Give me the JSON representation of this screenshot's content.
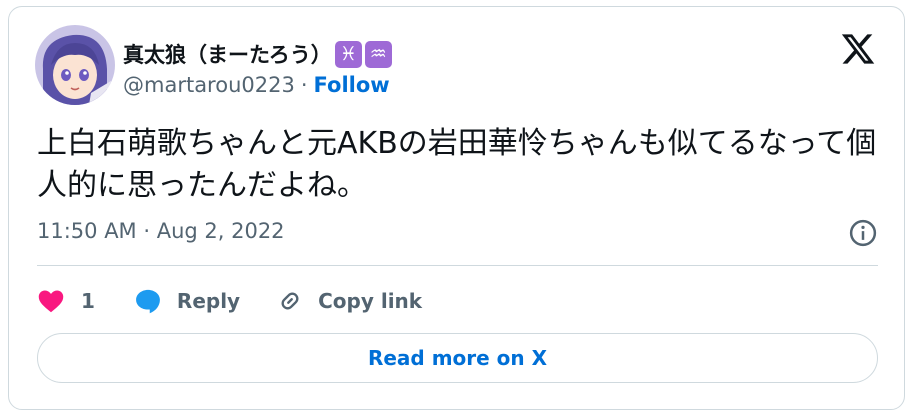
{
  "author": {
    "display_name": "真太狼（まーたろう）",
    "badges": [
      {
        "name": "pisces-icon",
        "glyph": "♓"
      },
      {
        "name": "aquarius-icon",
        "glyph": "♒"
      }
    ],
    "handle": "@martarou0223",
    "separator": "·",
    "follow_label": "Follow"
  },
  "tweet": {
    "text": "上白石萌歌ちゃんと元AKBの岩田華怜ちゃんも似てるなって個人的に思ったんだよね。",
    "timestamp": "11:50 AM · Aug 2, 2022"
  },
  "actions": {
    "like_count": "1",
    "reply_label": "Reply",
    "copy_link_label": "Copy link"
  },
  "read_more_label": "Read more on X",
  "colors": {
    "accent": "#006fd6",
    "like": "#f91880",
    "reply": "#1d9bf0",
    "secondary_text": "#536471",
    "border": "#cfd9de",
    "badge": "#9e6ad6"
  }
}
